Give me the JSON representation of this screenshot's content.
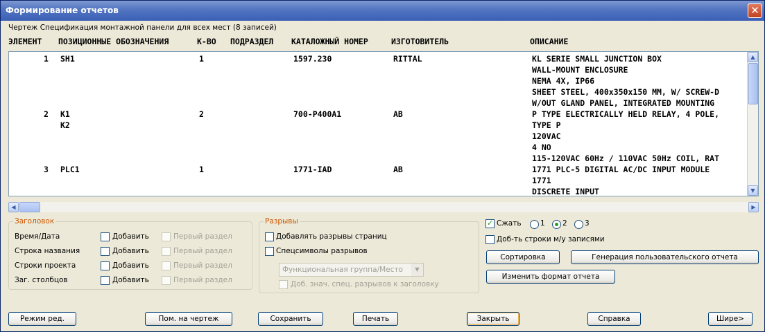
{
  "window": {
    "title": "Формирование отчетов",
    "close_symbol": "✕"
  },
  "subtitle": "Чертеж Спецификация монтажной панели для всех мест (8 записей)",
  "columns": [
    "ЭЛЕМЕНТ",
    "ПОЗИЦИОННЫЕ ОБОЗНАЧЕНИЯ",
    "К-ВО",
    "ПОДРАЗДЕЛ",
    "КАТАЛОЖНЫЙ НОМЕР",
    "ИЗГОТОВИТЕЛЬ",
    "ОПИСАНИЕ"
  ],
  "rows": [
    {
      "item": "1",
      "tags": [
        "SH1"
      ],
      "qty": "1",
      "catalog": "1597.230",
      "maker": "RITTAL",
      "desc": [
        "KL SERIE SMALL JUNCTION BOX",
        "WALL-MOUNT ENCLOSURE",
        "NEMA 4X, IP66",
        "SHEET STEEL, 400x350x150 MM, W/ SCREW-D",
        "W/OUT GLAND PANEL, INTEGRATED MOUNTING"
      ]
    },
    {
      "item": "2",
      "tags": [
        "K1",
        "K2"
      ],
      "qty": "2",
      "catalog": "700-P400A1",
      "maker": "AB",
      "desc": [
        "P TYPE ELECTRICALLY HELD RELAY, 4 POLE,",
        "TYPE P",
        "120VAC",
        "4 NO",
        "115-120VAC 60Hz / 110VAC 50Hz COIL, RAT"
      ]
    },
    {
      "item": "3",
      "tags": [
        "PLC1"
      ],
      "qty": "1",
      "catalog": "1771-IAD",
      "maker": "AB",
      "desc": [
        "1771 PLC-5 DIGITAL AC/DC INPUT MODULE",
        "1771",
        "DISCRETE INPUT"
      ]
    }
  ],
  "header_group": {
    "legend": "Заголовок",
    "rows": [
      {
        "label": "Время/Дата",
        "add": "Добавить",
        "first": "Первый раздел"
      },
      {
        "label": "Строка названия",
        "add": "Добавить",
        "first": "Первый раздел"
      },
      {
        "label": "Строки проекта",
        "add": "Добавить",
        "first": "Первый раздел"
      },
      {
        "label": "Заг. столбцов",
        "add": "Добавить",
        "first": "Первый раздел"
      }
    ]
  },
  "breaks_group": {
    "legend": "Разрывы",
    "page_breaks": "Добавлять разрывы страниц",
    "special_symbols": "Спецсимволы разрывов",
    "select_value": "Функциональная группа/Место",
    "add_special": "Доб. знач. спец. разрывов к заголовку"
  },
  "options": {
    "compress": "Сжать",
    "radios": [
      "1",
      "2",
      "3"
    ],
    "selected_radio": "2",
    "add_rows": "Доб-ть строки м/у записями",
    "sort": "Сортировка",
    "custom_report": "Генерация пользовательского отчета",
    "change_format": "Изменить формат отчета"
  },
  "bottom_buttons": {
    "edit_mode": "Режим ред.",
    "put_on_drawing": "Пом. на чертеж",
    "save": "Сохранить",
    "print": "Печать",
    "close": "Закрыть",
    "help": "Справка",
    "wider": "Шире>"
  },
  "icons": {
    "scroll_up": "▲",
    "scroll_down": "▼",
    "scroll_left": "◀",
    "scroll_right": "▶",
    "dropdown": "▼"
  }
}
